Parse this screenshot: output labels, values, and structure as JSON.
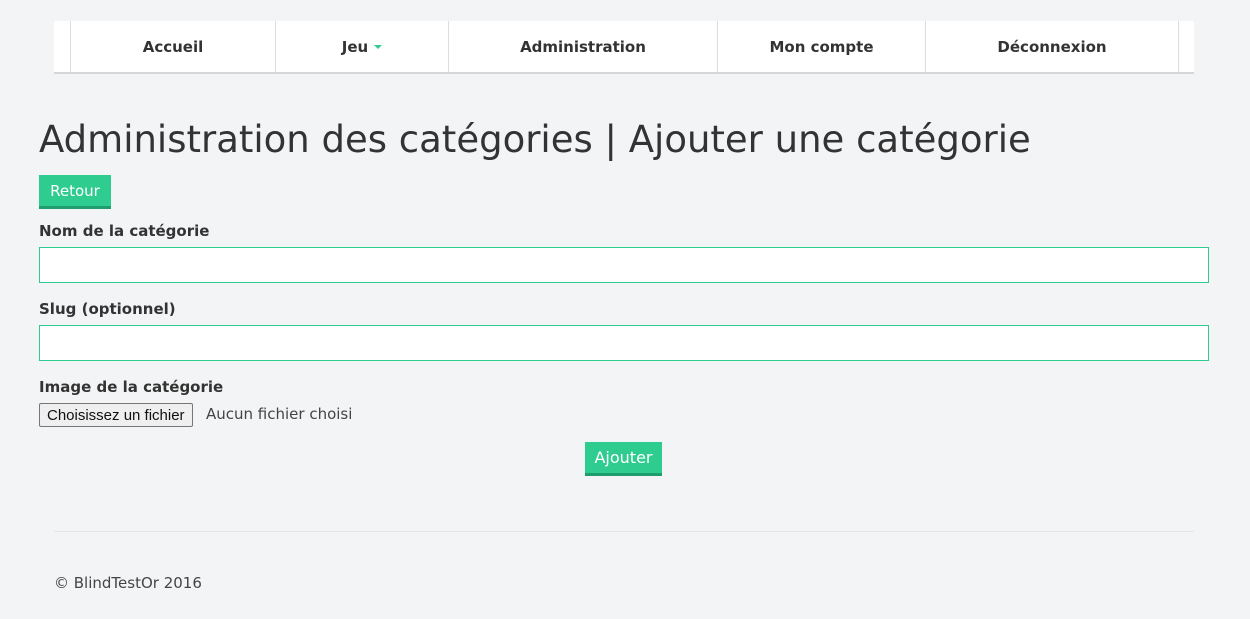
{
  "nav": {
    "items": [
      {
        "label": "Accueil"
      },
      {
        "label": "Jeu",
        "has_dropdown": true
      },
      {
        "label": "Administration"
      },
      {
        "label": "Mon compte"
      },
      {
        "label": "Déconnexion"
      }
    ]
  },
  "page": {
    "title": "Administration des catégories | Ajouter une catégorie",
    "back_label": "Retour"
  },
  "form": {
    "name_label": "Nom de la catégorie",
    "name_value": "",
    "slug_label": "Slug (optionnel)",
    "slug_value": "",
    "image_label": "Image de la catégorie",
    "file_button_label": "Choisissez un fichier",
    "file_status": "Aucun fichier choisi",
    "submit_label": "Ajouter"
  },
  "footer": {
    "copyright": "© BlindTestOr 2016"
  },
  "colors": {
    "accent": "#2ecc8f",
    "background": "#f3f4f6",
    "text": "#333333"
  }
}
